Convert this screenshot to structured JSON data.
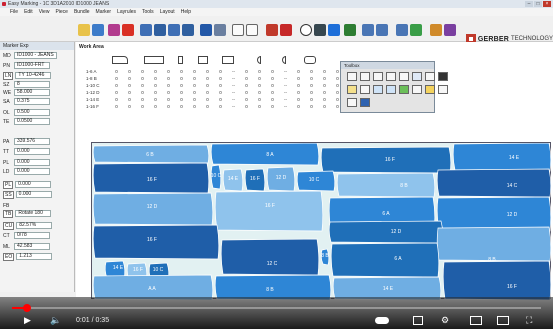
{
  "window": {
    "title": "Easy Marking - 1C 3D1A2010 ID1000 JEANS",
    "controls": [
      "–",
      "□",
      "×"
    ]
  },
  "menu": [
    "File",
    "Edit",
    "View",
    "Piece",
    "Bundle",
    "Marker",
    "Layrules",
    "Tools",
    "Layout",
    "Help"
  ],
  "brand": {
    "name": "GERBER",
    "suffix": "TECHNOLOGY"
  },
  "left_panel": {
    "header": "Marker Exp",
    "fields": [
      {
        "key": "MD",
        "value": "ID1000 - JEANS"
      },
      {
        "key": "PN",
        "value": "ID1000-FRT"
      },
      {
        "key": "LN",
        "value": "TY 10-4246",
        "boxed": true
      },
      {
        "key": "SZ",
        "value": "8"
      },
      {
        "key": "WE",
        "value": "58.000"
      },
      {
        "key": "SA",
        "value": "0.375"
      },
      {
        "key": "OL",
        "value": "0.500"
      },
      {
        "key": "TE",
        "value": "0.0500"
      },
      {
        "key": "PA",
        "value": "339.576"
      },
      {
        "key": "TT",
        "value": "0.000"
      },
      {
        "key": "PL",
        "value": "0.000"
      },
      {
        "key": "LD",
        "value": "0.000"
      },
      {
        "key": "PL",
        "value": "0.000",
        "boxed": true
      },
      {
        "key": "SS",
        "value": "0.000",
        "boxed": true
      },
      {
        "key": "FB",
        "value": ""
      },
      {
        "key": "TB",
        "value": "Rotate 180",
        "boxed": true
      },
      {
        "key": "CU",
        "value": "82.57%",
        "boxed": true
      },
      {
        "key": "CT",
        "value": "0/78"
      },
      {
        "key": "ML",
        "value": "42.583"
      },
      {
        "key": "EO",
        "value": "1.213",
        "boxed": true
      }
    ]
  },
  "work_area": {
    "title": "Work Area",
    "table": [
      {
        "label": "1-6  A",
        "cells": [
          "0",
          "0",
          "0",
          "0",
          "0",
          "0",
          "0",
          "0",
          "0",
          "--",
          "0",
          "0",
          "0",
          "--",
          "0",
          "0",
          "0",
          "0"
        ]
      },
      {
        "label": "1-8  B",
        "cells": [
          "0",
          "0",
          "0",
          "0",
          "0",
          "0",
          "0",
          "0",
          "0",
          "--",
          "0",
          "0",
          "0",
          "--",
          "0",
          "0",
          "0",
          "0"
        ]
      },
      {
        "label": "1-10 C",
        "cells": [
          "0",
          "0",
          "0",
          "0",
          "0",
          "0",
          "0",
          "0",
          "0",
          "--",
          "0",
          "0",
          "0",
          "--",
          "0",
          "0",
          "0",
          "0"
        ]
      },
      {
        "label": "1-12 D",
        "cells": [
          "0",
          "0",
          "0",
          "0",
          "0",
          "0",
          "0",
          "0",
          "0",
          "--",
          "0",
          "0",
          "0",
          "--",
          "0",
          "0",
          "0",
          "0"
        ]
      },
      {
        "label": "1-14 E",
        "cells": [
          "0",
          "0",
          "0",
          "0",
          "0",
          "0",
          "0",
          "0",
          "0",
          "--",
          "0",
          "0",
          "0",
          "--",
          "0",
          "0",
          "0",
          "0"
        ]
      },
      {
        "label": "1-16 F",
        "cells": [
          "0",
          "0",
          "0",
          "0",
          "0",
          "0",
          "0",
          "0",
          "0",
          "--",
          "0",
          "0",
          "0",
          "--",
          "0",
          "0",
          "0",
          "0"
        ]
      }
    ]
  },
  "toolbox": {
    "title": "Toolbox"
  },
  "marker": {
    "pieces": [
      {
        "label": "6 B"
      },
      {
        "label": "8 A"
      },
      {
        "label": "16 F"
      },
      {
        "label": "14 E"
      },
      {
        "label": "16 F"
      },
      {
        "label": "10 C"
      },
      {
        "label": "14 E"
      },
      {
        "label": "16 F"
      },
      {
        "label": "12 D"
      },
      {
        "label": "10 C"
      },
      {
        "label": "8 B"
      },
      {
        "label": "12 D"
      },
      {
        "label": "16 F"
      },
      {
        "label": "14 C"
      },
      {
        "label": "16 F"
      },
      {
        "label": "6 A"
      },
      {
        "label": "12 D"
      },
      {
        "label": "12 D"
      },
      {
        "label": "8 B"
      },
      {
        "label": "14 E"
      },
      {
        "label": "16 F"
      },
      {
        "label": "10 C"
      },
      {
        "label": "12 C"
      },
      {
        "label": "8 B"
      },
      {
        "label": "6 A"
      },
      {
        "label": "A A"
      },
      {
        "label": "8 B"
      },
      {
        "label": "14 E"
      },
      {
        "label": "16 F"
      }
    ]
  },
  "video": {
    "time": "0:01 / 0:35",
    "progress": 0.029,
    "accent": "#ff0000"
  }
}
